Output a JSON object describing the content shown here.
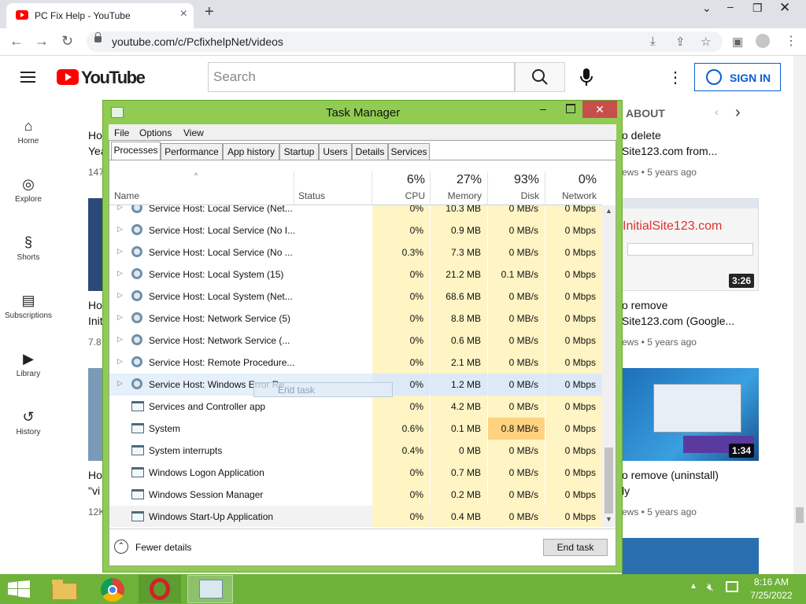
{
  "browser": {
    "tab_title": "PC Fix Help - YouTube",
    "url": "youtube.com/c/PcfixhelpNet/videos"
  },
  "youtube": {
    "logo_text": "YouTube",
    "search_placeholder": "Search",
    "sign_in": "SIGN IN",
    "about": "ABOUT",
    "sidebar": [
      {
        "label": "Home",
        "icon": "home-icon"
      },
      {
        "label": "Explore",
        "icon": "compass-icon"
      },
      {
        "label": "Shorts",
        "icon": "shorts-icon"
      },
      {
        "label": "Subscriptions",
        "icon": "subscriptions-icon"
      },
      {
        "label": "Library",
        "icon": "library-icon"
      },
      {
        "label": "History",
        "icon": "history-icon"
      }
    ],
    "left_column": {
      "row1": [
        "Ho",
        "Yea",
        "147"
      ],
      "row2": [
        "Ho",
        "Init",
        "7.8"
      ],
      "row3": [
        "Ho",
        "\"vi",
        "12K"
      ]
    },
    "right_column": [
      {
        "title_1": "o delete",
        "title_2": "Site123.com from...",
        "meta": "ews • 5 years ago"
      },
      {
        "thumb_text": "InitialSite123.com",
        "duration": "3:26",
        "title_1": "o remove",
        "title_2": "Site123.com (Google...",
        "meta": "ews • 5 years ago"
      },
      {
        "duration": "1:34",
        "title_1": "o remove (uninstall)",
        "title_2": "ly",
        "meta": "ews • 5 years ago"
      }
    ]
  },
  "task_manager": {
    "title": "Task Manager",
    "menu": [
      "File",
      "Options",
      "View"
    ],
    "tabs": [
      "Processes",
      "Performance",
      "App history",
      "Startup",
      "Users",
      "Details",
      "Services"
    ],
    "columns": {
      "name": "Name",
      "status": "Status",
      "cpu": {
        "pct": "6%",
        "label": "CPU"
      },
      "memory": {
        "pct": "27%",
        "label": "Memory"
      },
      "disk": {
        "pct": "93%",
        "label": "Disk"
      },
      "network": {
        "pct": "0%",
        "label": "Network"
      }
    },
    "rows": [
      {
        "name": "Service Host: Local Service (Net...",
        "cpu": "0%",
        "mem": "10.3 MB",
        "disk": "0 MB/s",
        "net": "0 Mbps",
        "expand": true,
        "icon": "gear-icon"
      },
      {
        "name": "Service Host: Local Service (No I...",
        "cpu": "0%",
        "mem": "0.9 MB",
        "disk": "0 MB/s",
        "net": "0 Mbps",
        "expand": true,
        "icon": "gear-icon"
      },
      {
        "name": "Service Host: Local Service (No ...",
        "cpu": "0.3%",
        "mem": "7.3 MB",
        "disk": "0 MB/s",
        "net": "0 Mbps",
        "expand": true,
        "icon": "gear-icon"
      },
      {
        "name": "Service Host: Local System (15)",
        "cpu": "0%",
        "mem": "21.2 MB",
        "disk": "0.1 MB/s",
        "net": "0 Mbps",
        "expand": true,
        "icon": "gear-icon"
      },
      {
        "name": "Service Host: Local System (Net...",
        "cpu": "0%",
        "mem": "68.6 MB",
        "disk": "0 MB/s",
        "net": "0 Mbps",
        "expand": true,
        "icon": "gear-icon"
      },
      {
        "name": "Service Host: Network Service (5)",
        "cpu": "0%",
        "mem": "8.8 MB",
        "disk": "0 MB/s",
        "net": "0 Mbps",
        "expand": true,
        "icon": "gear-icon"
      },
      {
        "name": "Service Host: Network Service (...",
        "cpu": "0%",
        "mem": "0.6 MB",
        "disk": "0 MB/s",
        "net": "0 Mbps",
        "expand": true,
        "icon": "gear-icon"
      },
      {
        "name": "Service Host: Remote Procedure...",
        "cpu": "0%",
        "mem": "2.1 MB",
        "disk": "0 MB/s",
        "net": "0 Mbps",
        "expand": true,
        "icon": "gear-icon"
      },
      {
        "name": "Service Host: Windows Error Re...",
        "cpu": "0%",
        "mem": "1.2 MB",
        "disk": "0 MB/s",
        "net": "0 Mbps",
        "expand": true,
        "icon": "gear-icon",
        "selected": true
      },
      {
        "name": "Services and Controller app",
        "cpu": "0%",
        "mem": "4.2 MB",
        "disk": "0 MB/s",
        "net": "0 Mbps",
        "expand": false,
        "icon": "app-window-icon"
      },
      {
        "name": "System",
        "cpu": "0.6%",
        "mem": "0.1 MB",
        "disk": "0.8 MB/s",
        "net": "0 Mbps",
        "expand": false,
        "icon": "app-window-icon",
        "disk_hot": true
      },
      {
        "name": "System interrupts",
        "cpu": "0.4%",
        "mem": "0 MB",
        "disk": "0 MB/s",
        "net": "0 Mbps",
        "expand": false,
        "icon": "app-window-icon"
      },
      {
        "name": "Windows Logon Application",
        "cpu": "0%",
        "mem": "0.7 MB",
        "disk": "0 MB/s",
        "net": "0 Mbps",
        "expand": false,
        "icon": "app-window-icon"
      },
      {
        "name": "Windows Session Manager",
        "cpu": "0%",
        "mem": "0.2 MB",
        "disk": "0 MB/s",
        "net": "0 Mbps",
        "expand": false,
        "icon": "app-window-icon"
      },
      {
        "name": "Windows Start-Up Application",
        "cpu": "0%",
        "mem": "0.4 MB",
        "disk": "0 MB/s",
        "net": "0 Mbps",
        "expand": false,
        "icon": "app-window-icon",
        "hover": true
      }
    ],
    "context_tooltip": "End task",
    "fewer_details": "Fewer details",
    "end_task": "End task"
  },
  "taskbar": {
    "time": "8:16 AM",
    "date": "7/25/2022"
  },
  "colors": {
    "tm_frame": "#90cc52",
    "taskbar": "#6fb23a",
    "cpu_heat": "#fff4c4",
    "disk_hot": "#ffd27f",
    "yt_red": "#ff0000",
    "link_blue": "#065fd4"
  }
}
